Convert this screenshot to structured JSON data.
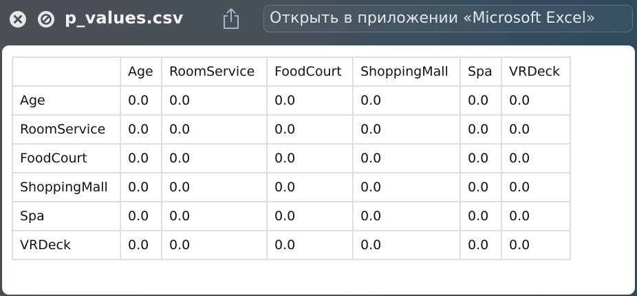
{
  "window": {
    "file_name": "p_values.csv",
    "open_in_app_label": "Открыть в приложении «Microsoft Excel»"
  },
  "icons": {
    "close": "close-icon",
    "no_entry": "no-entry-icon",
    "share": "share-icon"
  },
  "table": {
    "columns": [
      "",
      "Age",
      "RoomService",
      "FoodCourt",
      "ShoppingMall",
      "Spa",
      "VRDeck"
    ],
    "rows": [
      {
        "label": "Age",
        "values": [
          "0.0",
          "0.0",
          "0.0",
          "0.0",
          "0.0",
          "0.0"
        ]
      },
      {
        "label": "RoomService",
        "values": [
          "0.0",
          "0.0",
          "0.0",
          "0.0",
          "0.0",
          "0.0"
        ]
      },
      {
        "label": "FoodCourt",
        "values": [
          "0.0",
          "0.0",
          "0.0",
          "0.0",
          "0.0",
          "0.0"
        ]
      },
      {
        "label": "ShoppingMall",
        "values": [
          "0.0",
          "0.0",
          "0.0",
          "0.0",
          "0.0",
          "0.0"
        ]
      },
      {
        "label": "Spa",
        "values": [
          "0.0",
          "0.0",
          "0.0",
          "0.0",
          "0.0",
          "0.0"
        ]
      },
      {
        "label": "VRDeck",
        "values": [
          "0.0",
          "0.0",
          "0.0",
          "0.0",
          "0.0",
          "0.0"
        ]
      }
    ]
  }
}
